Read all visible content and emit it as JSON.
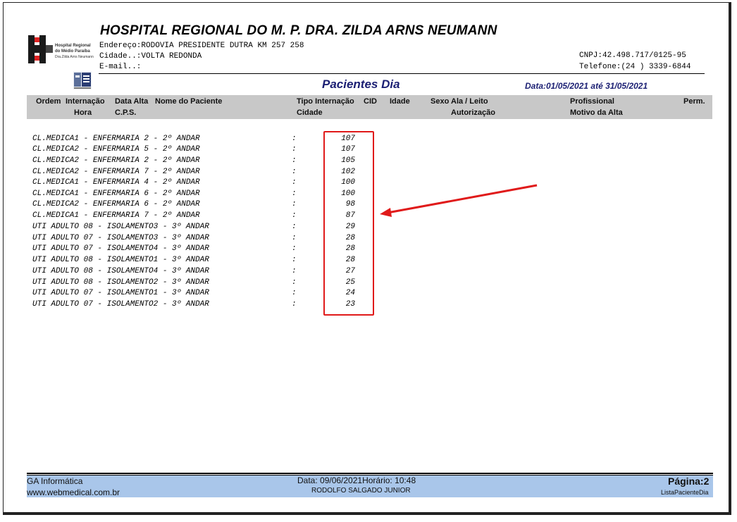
{
  "hospital": {
    "name": "HOSPITAL REGIONAL DO M. P. DRA. ZILDA ARNS NEUMANN",
    "logo_line1": "Hospital Regional",
    "logo_line2": "do Médio Paraíba",
    "logo_line3": "Dra.Zilda Arns Neumann",
    "address_label": "Endereço:",
    "address": "RODOVIA PRESIDENTE DUTRA KM 257 258",
    "city_label": "Cidade..:",
    "city": "VOLTA REDONDA",
    "email_label": "E-mail..:",
    "cnpj": "CNPJ:42.498.717/0125-95",
    "phone": "Telefone:(24 ) 3339-6844"
  },
  "report": {
    "title": "Pacientes Dia",
    "date_range": "Data:01/05/2021 até 31/05/2021"
  },
  "columns": {
    "ordem": "Ordem",
    "internacao": "Internação",
    "data_alta": "Data Alta",
    "nome": "Nome do Paciente",
    "tipo_internacao": "Tipo Internação",
    "cid": "CID",
    "idade": "Idade",
    "sexo": "Sexo",
    "ala_leito": "Ala / Leito",
    "profissional": "Profissional",
    "perm": "Perm.",
    "hora": "Hora",
    "cps": "C.P.S.",
    "cidade": "Cidade",
    "autorizacao": "Autorização",
    "motivo_alta": "Motivo da Alta"
  },
  "rows": [
    {
      "ward": "CL.MEDICA1 - ENFERMARIA 2 - 2º ANDAR",
      "sep": ":",
      "count": "107"
    },
    {
      "ward": "CL.MEDICA2 - ENFERMARIA 5 - 2º ANDAR",
      "sep": ":",
      "count": "107"
    },
    {
      "ward": "CL.MEDICA2 - ENFERMARIA 2 - 2º ANDAR",
      "sep": ":",
      "count": "105"
    },
    {
      "ward": "CL.MEDICA2 - ENFERMARIA 7 - 2º ANDAR",
      "sep": ":",
      "count": "102"
    },
    {
      "ward": "CL.MEDICA1 - ENFERMARIA 4 - 2º ANDAR",
      "sep": ":",
      "count": "100"
    },
    {
      "ward": "CL.MEDICA1 - ENFERMARIA 6 - 2º ANDAR",
      "sep": ":",
      "count": "100"
    },
    {
      "ward": "CL.MEDICA2 - ENFERMARIA 6 - 2º ANDAR",
      "sep": ":",
      "count": "98"
    },
    {
      "ward": "CL.MEDICA1 - ENFERMARIA 7 - 2º ANDAR",
      "sep": ":",
      "count": "87"
    },
    {
      "ward": "UTI ADULTO 08 - ISOLAMENTO3 - 3º ANDAR",
      "sep": ":",
      "count": "29"
    },
    {
      "ward": "UTI ADULTO 07 - ISOLAMENTO3 - 3º ANDAR",
      "sep": ":",
      "count": "28"
    },
    {
      "ward": "UTI ADULTO 07 - ISOLAMENTO4 - 3º ANDAR",
      "sep": ":",
      "count": "28"
    },
    {
      "ward": "UTI ADULTO 08 - ISOLAMENTO1 - 3º ANDAR",
      "sep": ":",
      "count": "28"
    },
    {
      "ward": "UTI ADULTO 08 - ISOLAMENTO4 - 3º ANDAR",
      "sep": ":",
      "count": "27"
    },
    {
      "ward": "UTI ADULTO 08 - ISOLAMENTO2 - 3º ANDAR",
      "sep": ":",
      "count": "25"
    },
    {
      "ward": "UTI ADULTO 07 - ISOLAMENTO1 - 3º ANDAR",
      "sep": ":",
      "count": "24"
    },
    {
      "ward": "UTI ADULTO 07 - ISOLAMENTO2 - 3º ANDAR",
      "sep": ":",
      "count": "23"
    }
  ],
  "annotation": {
    "box_color": "#e01a1a",
    "arrow_color": "#e01a1a"
  },
  "footer": {
    "company": "GA Informática",
    "website": "www.webmedical.com.br",
    "date_time": "Data: 09/06/2021Horário: 10:48",
    "user": "RODOLFO SALGADO JUNIOR",
    "page_label": "Página:",
    "page_number": "2",
    "report_name": "ListaPacienteDia",
    "band_color": "#a9c6ea"
  }
}
